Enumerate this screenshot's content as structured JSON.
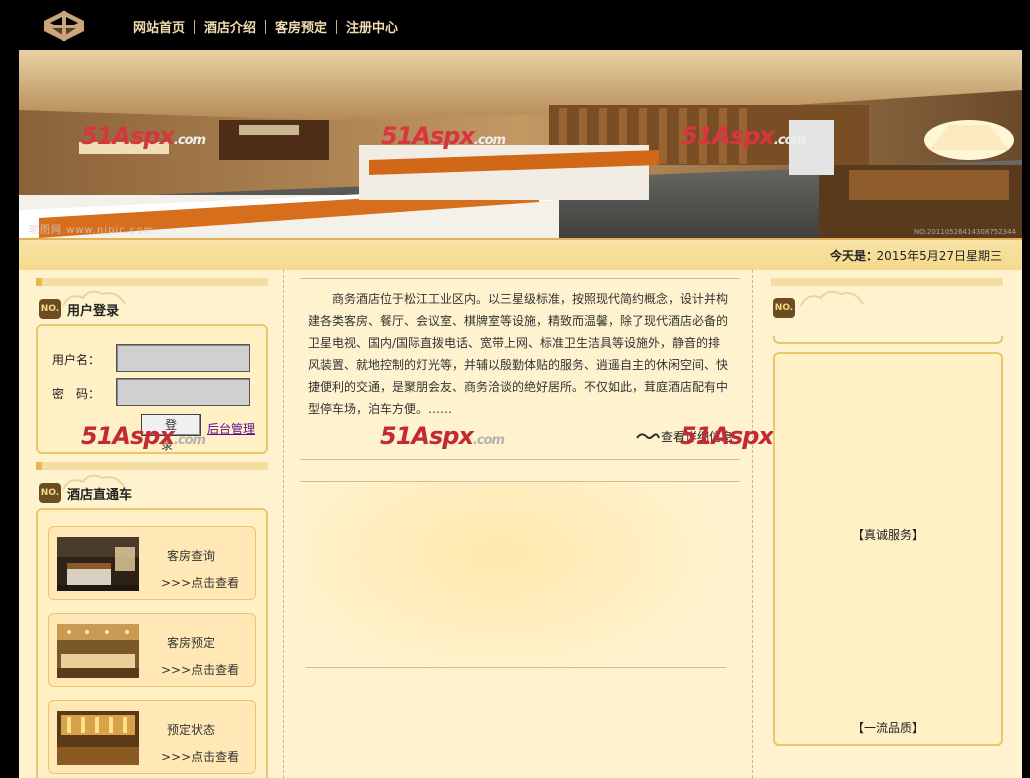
{
  "nav": {
    "items": [
      "网站首页",
      "酒店介绍",
      "客房预定",
      "注册中心"
    ]
  },
  "banner": {
    "watermark_brand": "51Aspx",
    "watermark_suffix": ".com",
    "credit": "昵图网 www.nipic.com",
    "credit_code": "NO:20110526414308752344"
  },
  "datebar": {
    "label": "今天是：",
    "value": "2015年5月27日星期三"
  },
  "login": {
    "badge": "NO.",
    "title": "用户登录",
    "username_label": "用户名：",
    "password_label": "密　码：",
    "username_value": "",
    "password_value": "",
    "submit_label": "登 录",
    "admin_link": "后台管理"
  },
  "direct": {
    "badge": "NO.",
    "title": "酒店直通车",
    "cards": [
      {
        "name": "客房查询",
        "link": ">>>点击查看"
      },
      {
        "name": "客房预定",
        "link": ">>>点击查看"
      },
      {
        "name": "预定状态",
        "link": ">>>点击查看"
      }
    ]
  },
  "intro": {
    "text": "商务酒店位于松江工业区内。以三星级标准，按照现代简约概念，设计并构建各类客房、餐厅、会议室、棋牌室等设施，精致而温馨，除了现代酒店必备的卫星电视、国内/国际直拨电话、宽带上网、标准卫生洁具等设施外，静音的排风装置、就地控制的灯光等，并辅以殷勤体贴的服务、逍遥自主的休闲空间、快捷便利的交通，是聚朋会友、商务洽谈的绝好居所。不仅如此，茸庭酒店配有中型停车场，泊车方便。……",
    "more_label": "查看详细信息"
  },
  "right": {
    "badge": "NO.",
    "label_top": "【真诚服务】",
    "label_bottom": "【一流品质】"
  },
  "colors": {
    "accent_gold": "#ecc56f",
    "content_bg": "#fff3cf",
    "nav_text": "#f1dcb3",
    "watermark_red": "#c22a34"
  }
}
